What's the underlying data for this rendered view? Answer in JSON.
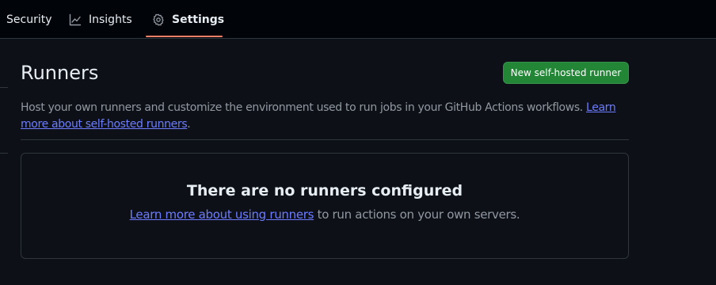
{
  "nav": {
    "tabs": [
      {
        "label": "Security",
        "icon": null,
        "selected": false
      },
      {
        "label": "Insights",
        "icon": "graph-icon",
        "selected": false
      },
      {
        "label": "Settings",
        "icon": "gear-icon",
        "selected": true
      }
    ]
  },
  "header": {
    "title": "Runners",
    "new_runner_button": "New self-hosted runner"
  },
  "description": {
    "text": "Host your own runners and customize the environment used to run jobs in your GitHub Actions workflows. ",
    "link": "Learn more about self-hosted runners",
    "suffix": "."
  },
  "empty_state": {
    "title": "There are no runners configured",
    "link": "Learn more about using runners",
    "text": " to run actions on your own servers."
  },
  "colors": {
    "background": "#0d1117",
    "nav_background": "#010409",
    "accent_underline": "#f78166",
    "primary_button": "#238636",
    "link": "#6d7cff",
    "border": "#30363d"
  }
}
